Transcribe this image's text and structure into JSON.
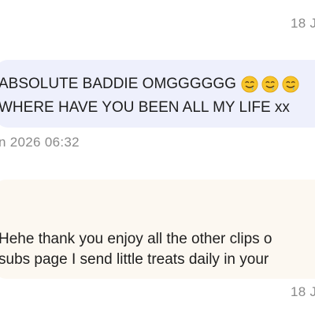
{
  "messages": {
    "top_timestamp": "18 J",
    "received": {
      "line1": "ABSOLUTE BADDIE OMGGGGGG",
      "emoji": "drooling-face",
      "emoji_count": 3,
      "line2": "WHERE HAVE YOU BEEN ALL MY LIFE xx",
      "timestamp": "n 2026 06:32"
    },
    "sent": {
      "line1": "Hehe thank you enjoy all the other clips o",
      "line2": "subs page I send little treats daily in your",
      "timestamp": "18 J"
    }
  },
  "colors": {
    "received_bubble": "#eef0fc",
    "sent_bubble": "#fcf8f1",
    "timestamp": "#8a8a8a",
    "text": "#1e1e1e"
  }
}
